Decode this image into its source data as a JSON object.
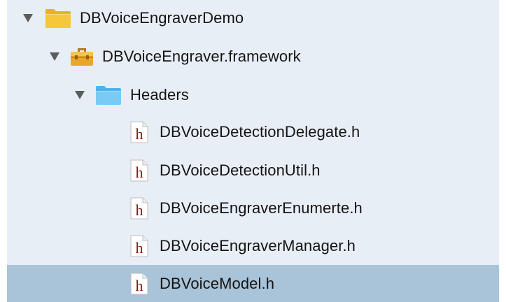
{
  "tree": {
    "project": {
      "label": "DBVoiceEngraverDemo",
      "icon": "folder-icon",
      "expanded": true
    },
    "framework": {
      "label": "DBVoiceEngraver.framework",
      "icon": "framework-toolbox-icon",
      "expanded": true
    },
    "headers_folder": {
      "label": "Headers",
      "icon": "folder-icon",
      "expanded": true
    },
    "files": [
      {
        "label": "DBVoiceDetectionDelegate.h",
        "icon": "header-file-icon",
        "selected": false
      },
      {
        "label": "DBVoiceDetectionUtil.h",
        "icon": "header-file-icon",
        "selected": false
      },
      {
        "label": "DBVoiceEngraverEnumerte.h",
        "icon": "header-file-icon",
        "selected": false
      },
      {
        "label": "DBVoiceEngraverManager.h",
        "icon": "header-file-icon",
        "selected": false
      },
      {
        "label": "DBVoiceModel.h",
        "icon": "header-file-icon",
        "selected": true
      }
    ],
    "file_icon_letter": "h"
  },
  "colors": {
    "panel_background": "#e8eef6",
    "selection": "#a9c3d8",
    "folder_yellow": "#f4c430",
    "folder_blue": "#6ec6f5",
    "header_letter": "#8b1a1a"
  }
}
